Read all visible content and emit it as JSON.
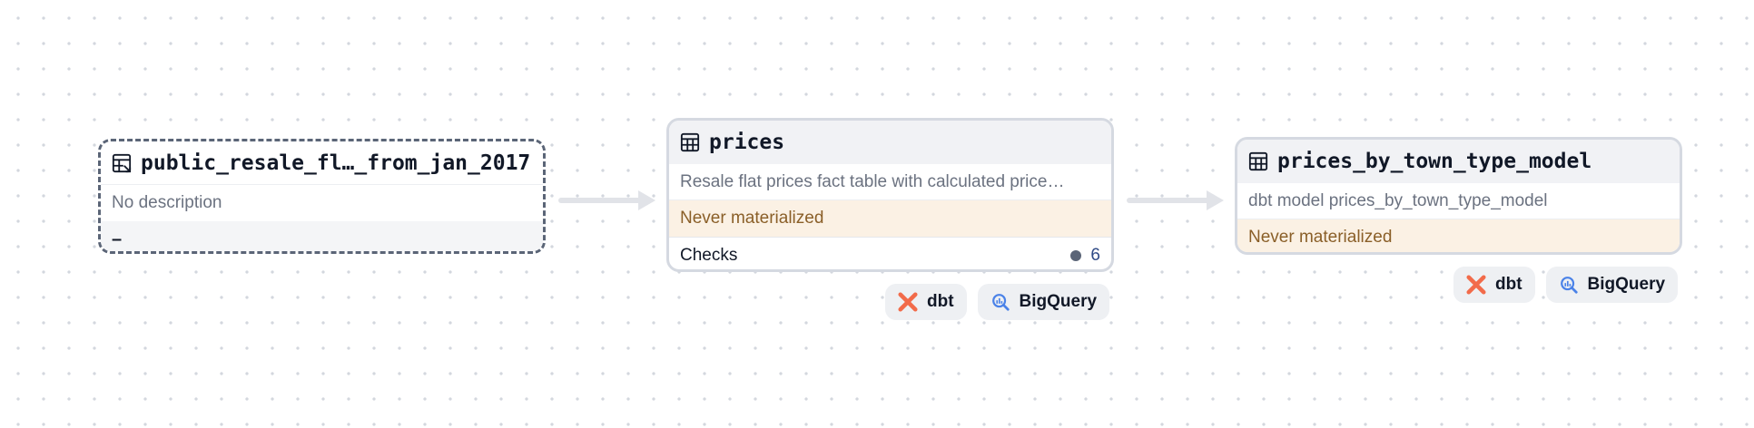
{
  "nodes": [
    {
      "id": "source",
      "title": "public_resale_fl…_from_jan_2017",
      "icon": "source-table-icon",
      "description": "No description",
      "value": "–"
    },
    {
      "id": "prices",
      "title": "prices",
      "icon": "table-icon",
      "description": "Resale flat prices fact table with calculated price…",
      "status": "Never materialized",
      "checks_label": "Checks",
      "checks_count": "6",
      "tags": [
        {
          "label": "dbt",
          "icon": "dbt-icon"
        },
        {
          "label": "BigQuery",
          "icon": "bigquery-icon"
        }
      ]
    },
    {
      "id": "prices_by_town_type_model",
      "title": "prices_by_town_type_model",
      "icon": "table-icon",
      "description": "dbt model prices_by_town_type_model",
      "status": "Never materialized",
      "tags": [
        {
          "label": "dbt",
          "icon": "dbt-icon"
        },
        {
          "label": "BigQuery",
          "icon": "bigquery-icon"
        }
      ]
    }
  ],
  "colors": {
    "dbt": "#f26b4a",
    "bigquery": "#4a82e8",
    "status_bg": "#fbf1e4",
    "status_text": "#8a5f28",
    "source_border": "#5b6577"
  }
}
